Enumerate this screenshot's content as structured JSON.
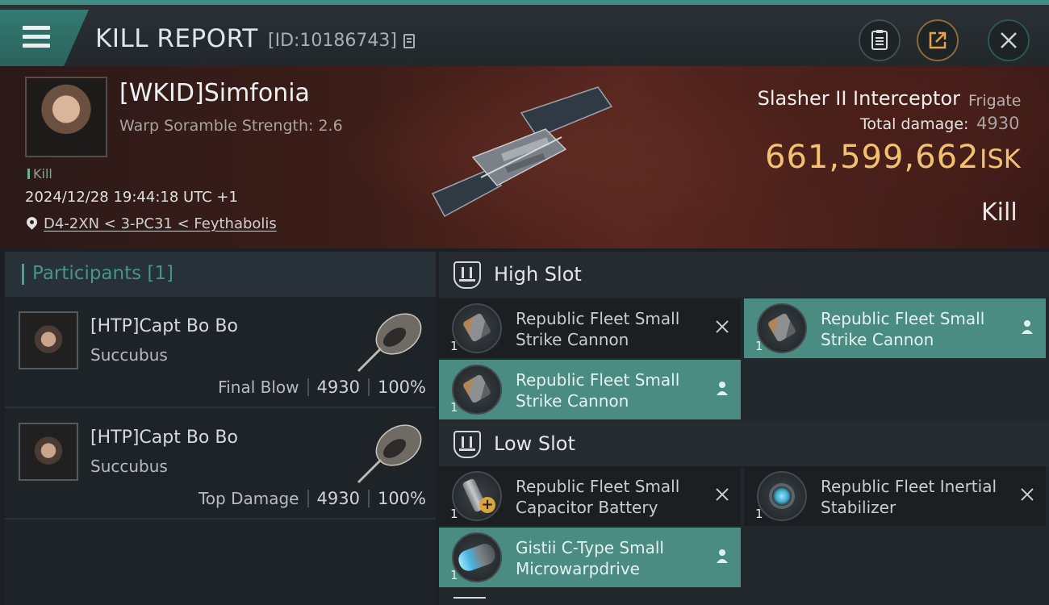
{
  "header": {
    "title": "KILL REPORT",
    "id": "[ID:10186743]"
  },
  "victim": {
    "name": "[WKID]Simfonia",
    "subtitle": "Warp Soramble Strength: 2.6",
    "tag": "Kill",
    "timestamp": "2024/12/28 19:44:18 UTC +1",
    "location": "D4-2XN < 3-PC31 < Feythabolis"
  },
  "ship": {
    "name": "Slasher II Interceptor",
    "class": "Frigate",
    "damage_label": "Total damage:",
    "damage_value": "4930",
    "isk_value": "661,599,662",
    "isk_unit": "ISK",
    "result": "Kill"
  },
  "participants": {
    "title": "Participants [1]",
    "rows": [
      {
        "name": "[HTP]Capt Bo Bo",
        "ship": "Succubus",
        "label": "Final Blow",
        "damage": "4930",
        "percent": "100%"
      },
      {
        "name": "[HTP]Capt Bo Bo",
        "ship": "Succubus",
        "label": "Top Damage",
        "damage": "4930",
        "percent": "100%"
      }
    ]
  },
  "fitting": {
    "high_slot": {
      "title": "High Slot",
      "modules": [
        {
          "qty": "1",
          "name": "Republic Fleet Small Strike Cannon",
          "state": "destroyed"
        },
        {
          "qty": "1",
          "name": "Republic Fleet Small Strike Cannon",
          "state": "dropped"
        },
        {
          "qty": "1",
          "name": "Republic Fleet Small Strike Cannon",
          "state": "dropped"
        }
      ]
    },
    "low_slot": {
      "title": "Low Slot",
      "modules": [
        {
          "qty": "1",
          "name": "Republic Fleet Small Capacitor Battery",
          "state": "destroyed"
        },
        {
          "qty": "1",
          "name": "Republic Fleet Inertial Stabilizer",
          "state": "destroyed"
        },
        {
          "qty": "1",
          "name": "Gistii C-Type Small Microwarpdrive",
          "state": "dropped"
        }
      ]
    }
  },
  "colors": {
    "accent": "#3f8f86",
    "isk_gold": "#f2c270",
    "fitted_module": "#4a8b82"
  },
  "icons": [
    "menu-icon",
    "copy-icon",
    "report-icon",
    "share-icon",
    "close-icon",
    "location-pin-icon",
    "slot-icon",
    "destroyed-x-icon",
    "dropped-person-icon"
  ]
}
